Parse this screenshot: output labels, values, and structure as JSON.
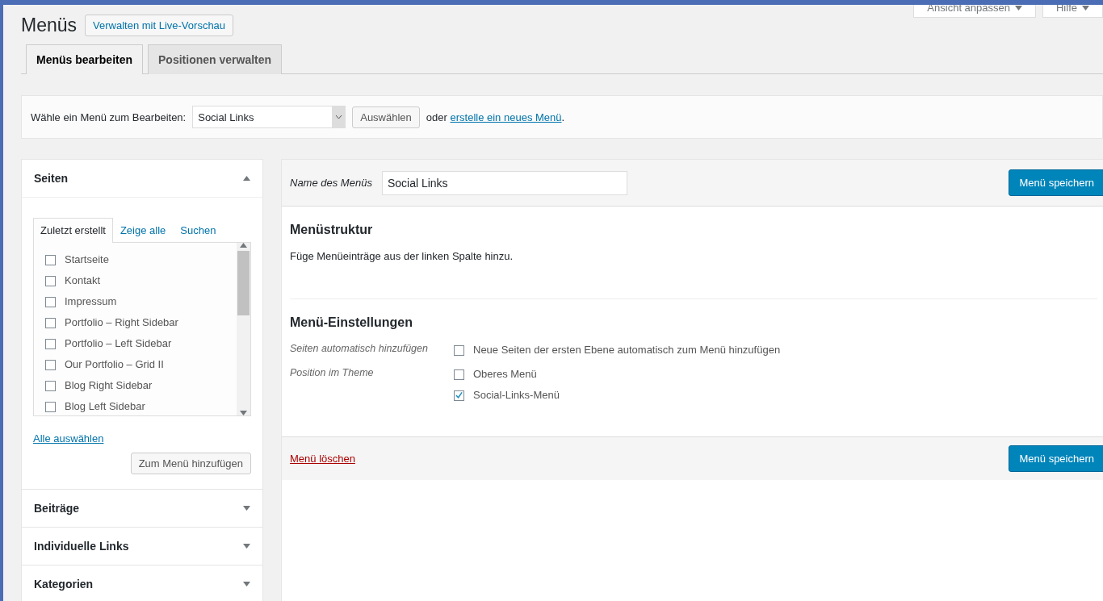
{
  "page": {
    "title": "Menüs",
    "live_preview_button": "Verwalten mit Live-Vorschau",
    "screen_options": [
      {
        "label": "Ansicht anpassen"
      },
      {
        "label": "Hilfe"
      }
    ]
  },
  "tabs": [
    {
      "label": "Menüs bearbeiten",
      "selected": true
    },
    {
      "label": "Positionen verwalten",
      "selected": false
    }
  ],
  "menu_select": {
    "label": "Wähle ein Menü zum Bearbeiten:",
    "value": "Social Links",
    "button": "Auswählen",
    "or_text": "oder",
    "create_link": "erstelle ein neues Menü",
    "trailing": "."
  },
  "sidebar": {
    "sections": [
      {
        "title": "Seiten",
        "expanded": true,
        "tabs": [
          {
            "label": "Zuletzt erstellt",
            "selected": true
          },
          {
            "label": "Zeige alle",
            "selected": false
          },
          {
            "label": "Suchen",
            "selected": false
          }
        ],
        "items": [
          {
            "label": "Startseite",
            "checked": false
          },
          {
            "label": "Kontakt",
            "checked": false
          },
          {
            "label": "Impressum",
            "checked": false
          },
          {
            "label": "Portfolio – Right Sidebar",
            "checked": false
          },
          {
            "label": "Portfolio – Left Sidebar",
            "checked": false
          },
          {
            "label": "Our Portfolio – Grid II",
            "checked": false
          },
          {
            "label": "Blog Right Sidebar",
            "checked": false
          },
          {
            "label": "Blog Left Sidebar",
            "checked": false
          }
        ],
        "select_all": "Alle auswählen",
        "add_button": "Zum Menü hinzufügen"
      },
      {
        "title": "Beiträge",
        "expanded": false
      },
      {
        "title": "Individuelle Links",
        "expanded": false
      },
      {
        "title": "Kategorien",
        "expanded": false
      }
    ]
  },
  "editor": {
    "name_label": "Name des Menüs",
    "name_value": "Social Links",
    "save_button": "Menü speichern",
    "structure_title": "Menüstruktur",
    "structure_hint": "Füge Menüeinträge aus der linken Spalte hinzu.",
    "settings_title": "Menü-Einstellungen",
    "settings": [
      {
        "label": "Seiten automatisch hinzufügen",
        "options": [
          {
            "label": "Neue Seiten der ersten Ebene automatisch zum Menü hinzufügen",
            "checked": false
          }
        ]
      },
      {
        "label": "Position im Theme",
        "options": [
          {
            "label": "Oberes Menü",
            "checked": false
          },
          {
            "label": "Social-Links-Menü",
            "checked": true
          }
        ]
      }
    ],
    "delete_link": "Menü löschen",
    "save_button_bottom": "Menü speichern"
  }
}
